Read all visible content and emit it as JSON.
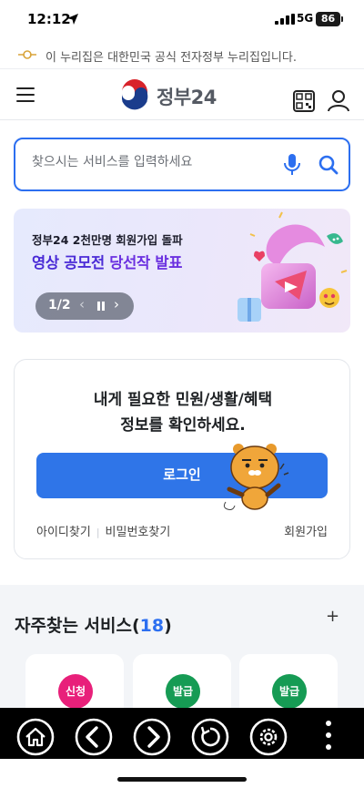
{
  "status_bar": {
    "time": "12:12",
    "network": "5G",
    "battery": "86"
  },
  "gov_banner": {
    "text": "이 누리집은 대한민국 공식 전자정부 누리집입니다."
  },
  "header": {
    "logo_text": "정부24",
    "menu_icon": "hamburger-menu-icon",
    "qr_icon": "qr-code-icon",
    "user_icon": "user-icon"
  },
  "search": {
    "placeholder": "찾으시는 서비스를 입력하세요",
    "value": ""
  },
  "promo": {
    "line1": "정부24  2천만명 회원가입 돌파",
    "line2_a": "영상 공모전 ",
    "line2_b": "당선작 발표",
    "pager": "1/2"
  },
  "login_card": {
    "message_line1": "내게 필요한 민원/생활/혜택",
    "message_line2": "정보를 확인하세요.",
    "login_button": "로그인",
    "find_id": "아이디찾기",
    "find_password": "비밀번호찾기",
    "signup": "회원가입"
  },
  "frequent_services": {
    "title": "자주찾는 서비스",
    "count_open": "(",
    "count": "18",
    "count_close": ")",
    "add": "+",
    "cards": [
      {
        "badge": "신청",
        "color": "#e8207a"
      },
      {
        "badge": "발급",
        "color": "#169b54"
      },
      {
        "badge": "발급",
        "color": "#169b54"
      }
    ]
  },
  "colors": {
    "accent": "#2f75e8",
    "search_border": "#2c6ff0",
    "promo_purple": "#4a2bd6"
  },
  "bottom_nav": [
    "home-icon",
    "back-icon",
    "forward-icon",
    "refresh-icon",
    "settings-icon",
    "more-icon"
  ]
}
